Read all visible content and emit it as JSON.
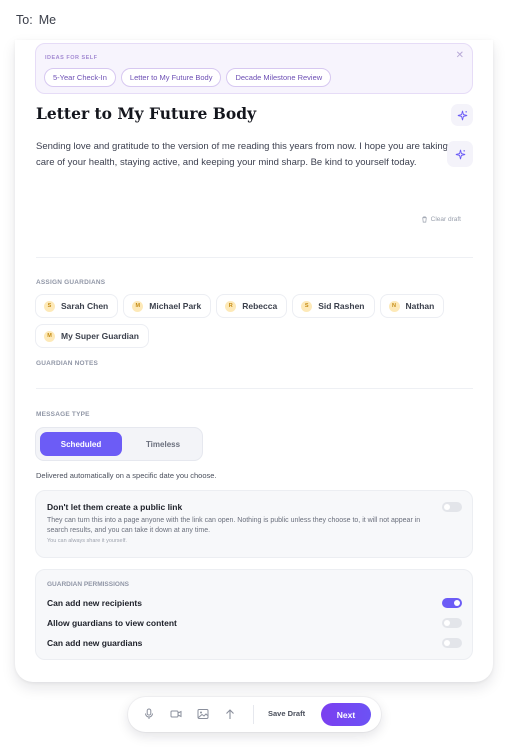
{
  "header": {
    "to_label": "To:",
    "to_value": "Me"
  },
  "ideas": {
    "title": "IDEAS FOR SELF",
    "chips": [
      "5-Year Check-In",
      "Letter to My Future Body",
      "Decade Milestone Review"
    ]
  },
  "letter": {
    "title": "Letter to My Future Body",
    "body": "Sending love and gratitude to the version of me reading this years from now. I hope you are taking care of your health, staying active, and keeping your mind sharp. Be kind to yourself today.",
    "clear_draft": "Clear draft"
  },
  "guardians": {
    "label": "ASSIGN GUARDIANS",
    "items": [
      {
        "initial": "S",
        "name": "Sarah Chen"
      },
      {
        "initial": "M",
        "name": "Michael Park"
      },
      {
        "initial": "R",
        "name": "Rebecca"
      },
      {
        "initial": "S",
        "name": "Sid Rashen"
      },
      {
        "initial": "N",
        "name": "Nathan"
      },
      {
        "initial": "M",
        "name": "My Super Guardian"
      }
    ],
    "notes_label": "GUARDIAN NOTES"
  },
  "message_type": {
    "label": "MESSAGE TYPE",
    "options": [
      "Scheduled",
      "Timeless"
    ],
    "selected": "Scheduled",
    "description": "Delivered automatically on a specific date you choose."
  },
  "public_link": {
    "title": "Don't let them create a public link",
    "description": "They can turn this into a page anyone with the link can open. Nothing is public unless they choose to, it will not appear in search results, and you can take it down at any time.",
    "note": "You can always share it yourself.",
    "enabled": false
  },
  "permissions": {
    "label": "GUARDIAN PERMISSIONS",
    "items": [
      {
        "label": "Can add new recipients",
        "enabled": true
      },
      {
        "label": "Allow guardians to view content",
        "enabled": false
      },
      {
        "label": "Can add new guardians",
        "enabled": false
      }
    ]
  },
  "dock": {
    "icons": [
      "microphone-icon",
      "video-icon",
      "image-icon",
      "upload-icon"
    ],
    "save_draft": "Save Draft",
    "next": "Next"
  },
  "colors": {
    "accent": "#6c5cf6",
    "idea_bg": "#f7f4fd",
    "avatar_bg": "#fde9b8"
  }
}
